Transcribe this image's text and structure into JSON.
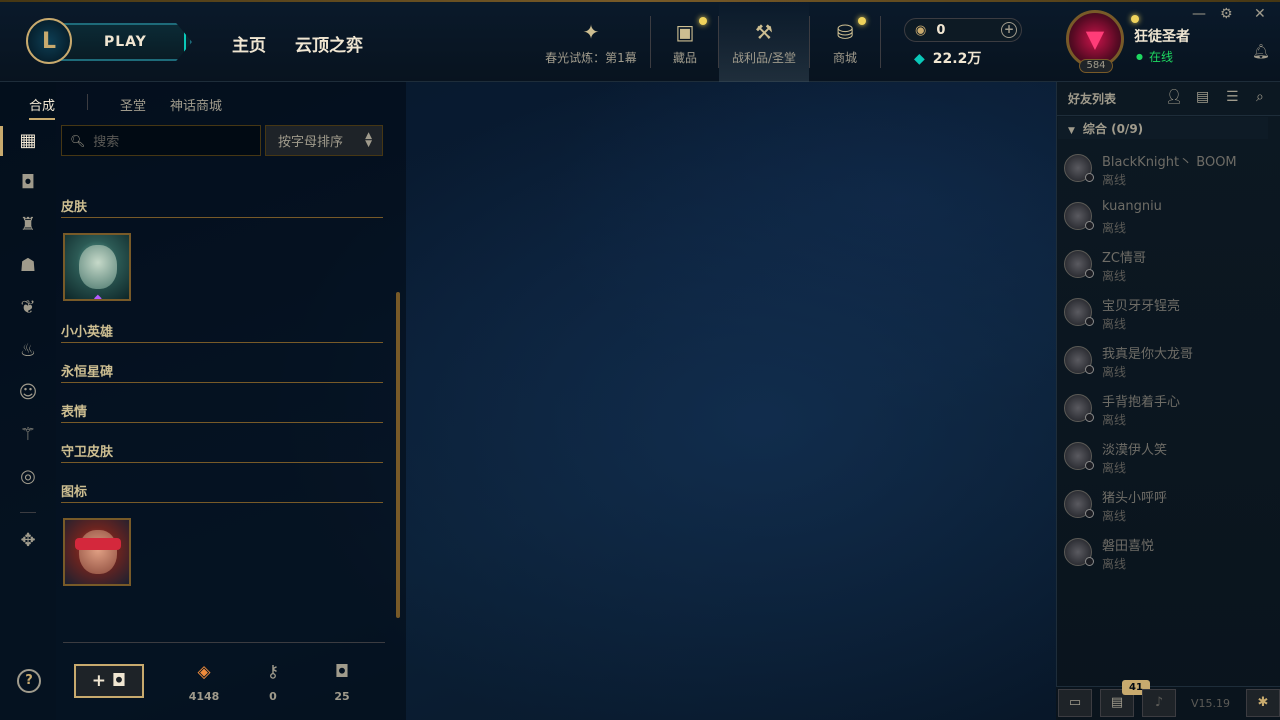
{
  "header": {
    "play_label": "PLAY",
    "nav_home": "主页",
    "nav_tft": "云顶之弈",
    "nav_items": [
      {
        "label": "春光试炼：第1幕",
        "icon": "event-pass-icon"
      },
      {
        "label": "藏品",
        "icon": "collection-chest-icon"
      },
      {
        "label": "战利品/圣堂",
        "icon": "loot-hammer-icon"
      },
      {
        "label": "商城",
        "icon": "store-coins-icon"
      }
    ],
    "rp_amount": "0",
    "be_amount": "22.2万",
    "username": "狂徒圣者",
    "status": "在线",
    "level": "584"
  },
  "subtabs": [
    "合成",
    "圣堂",
    "神话商城"
  ],
  "search": {
    "placeholder": "搜索"
  },
  "sort": {
    "label": "按字母排序"
  },
  "sections": [
    "皮肤",
    "小小英雄",
    "永恒星碑",
    "表情",
    "守卫皮肤",
    "图标"
  ],
  "stats": [
    {
      "value": "4148",
      "icon": "orange-essence-icon"
    },
    {
      "value": "0",
      "icon": "key-icon"
    },
    {
      "value": "25",
      "icon": "chest-icon"
    }
  ],
  "friends": {
    "title": "好友列表",
    "group": "综合 (0/9)",
    "list": [
      {
        "name": "BlackKnight丶 BOOM",
        "status": "离线"
      },
      {
        "name": "kuangniu",
        "status": "离线"
      },
      {
        "name": "ZC情哥",
        "status": "离线"
      },
      {
        "name": "宝贝牙牙锃亮",
        "status": "离线"
      },
      {
        "name": "我真是你大龙哥",
        "status": "离线"
      },
      {
        "name": "手背抱着手心",
        "status": "离线"
      },
      {
        "name": "淡漠伊人笑",
        "status": "离线"
      },
      {
        "name": "猪头小呼呼",
        "status": "离线"
      },
      {
        "name": "磐田喜悦",
        "status": "离线"
      }
    ]
  },
  "bottom": {
    "badge": "41",
    "version": "V15.19"
  },
  "colors": {
    "gold": "#c8aa6e",
    "teal": "#0ac8b9",
    "online": "#1ed760",
    "background": "#010a13"
  }
}
